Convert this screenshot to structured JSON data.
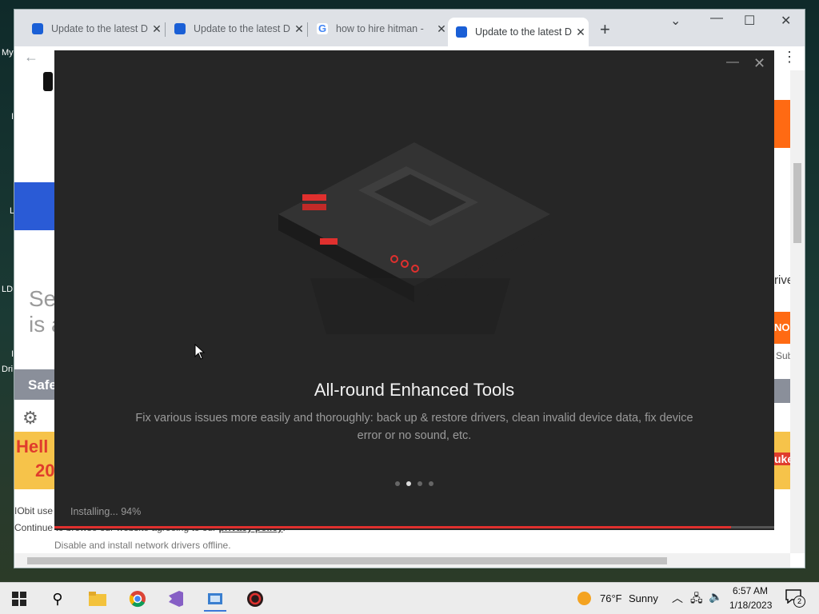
{
  "desktop": {
    "labels": [
      "My",
      "I",
      "L",
      "LD",
      "I",
      "Dri"
    ]
  },
  "browser": {
    "tabs": [
      {
        "title": "Update to the latest D",
        "favicon": "iobit-icon",
        "active": false
      },
      {
        "title": "Update to the latest D",
        "favicon": "iobit-icon",
        "active": false
      },
      {
        "title": "how to hire hitman -",
        "favicon": "google-icon",
        "active": false
      },
      {
        "title": "Update to the latest D",
        "favicon": "iobit-icon",
        "active": true
      }
    ],
    "new_tab_label": "+",
    "page_fragments": {
      "left_big_text": [
        "Se",
        "is a"
      ],
      "safe_label": "Safe",
      "hello_banner": [
        "Hell",
        "20"
      ],
      "right_drive": "rive",
      "right_no": "NO",
      "right_sub": "Sub",
      "right_uke": "uke",
      "footer_line1_prefix": "IObit use",
      "footer_line2": "Continue to browse our website agreeing to our",
      "privacy_link": "privacy policy",
      "footer_line3": "Disable and install network drivers offline."
    }
  },
  "installer": {
    "headline": "All-round Enhanced Tools",
    "description": "Fix various issues more easily and thoroughly: back up & restore drivers, clean invalid device data, fix device error or no sound, etc.",
    "carousel": {
      "count": 4,
      "active_index": 1
    },
    "status_text": "Installing... 94%",
    "progress": 0.94,
    "accent_color": "#e0302e"
  },
  "taskbar": {
    "weather_temp": "76°F",
    "weather_desc": "Sunny",
    "time": "6:57 AM",
    "date": "1/18/2023",
    "notification_count": "2"
  }
}
